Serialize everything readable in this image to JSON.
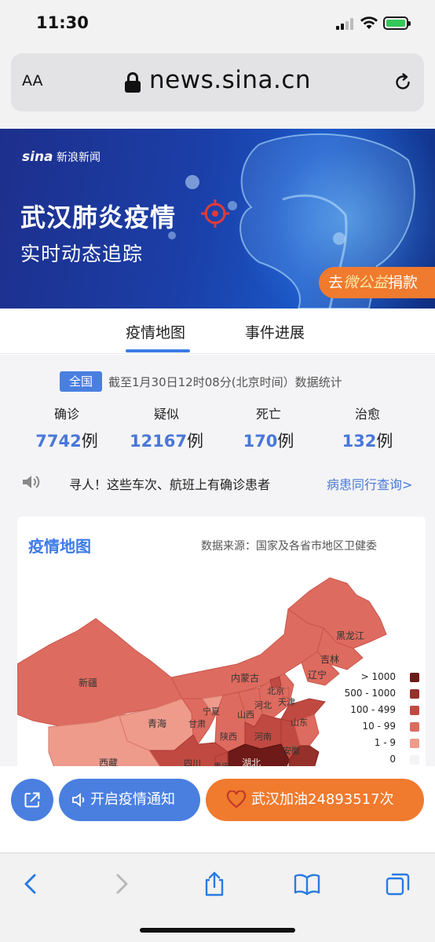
{
  "status_bar": {
    "time": "11:30"
  },
  "browser": {
    "aa_label": "AA",
    "url": "news.sina.cn"
  },
  "banner": {
    "logo_en": "sina",
    "logo_cn": "新浪新闻",
    "title": "武汉肺炎疫情",
    "subtitle": "实时动态追踪",
    "donate_prefix": "去",
    "donate_brand": "微公益",
    "donate_suffix": "捐款"
  },
  "tabs": [
    {
      "label": "疫情地图",
      "active": true
    },
    {
      "label": "事件进展",
      "active": false
    }
  ],
  "stats": {
    "scope_badge": "全国",
    "updated_text": "截至1月30日12时08分(北京时间）数据统计",
    "unit": "例",
    "items": [
      {
        "label": "确诊",
        "value": "7742"
      },
      {
        "label": "疑似",
        "value": "12167"
      },
      {
        "label": "死亡",
        "value": "170"
      },
      {
        "label": "治愈",
        "value": "132"
      }
    ]
  },
  "notice": {
    "text": "寻人！这些车次、航班上有确诊患者",
    "link": "病患同行查询>"
  },
  "map": {
    "title": "疫情地图",
    "source": "数据来源：国家及各省市地区卫健委",
    "regions": [
      "黑龙江",
      "吉林",
      "辽宁",
      "内蒙古",
      "北京",
      "天津",
      "河北",
      "山西",
      "山东",
      "宁夏",
      "甘肃",
      "陕西",
      "河南",
      "新疆",
      "青海",
      "西藏",
      "四川",
      "湖北",
      "安徽",
      "重庆"
    ],
    "legend": [
      {
        "label": "> 1000",
        "color": "#6e1a18"
      },
      {
        "label": "500 - 1000",
        "color": "#96302a"
      },
      {
        "label": "100 - 499",
        "color": "#c04a42"
      },
      {
        "label": "10 - 99",
        "color": "#de6b5f"
      },
      {
        "label": "1 - 9",
        "color": "#ee9b8c"
      },
      {
        "label": "0",
        "color": "#f4f4f4"
      }
    ]
  },
  "actions": {
    "notify_label": "开启疫情通知",
    "cheer_label": "武汉加油24893517次"
  }
}
